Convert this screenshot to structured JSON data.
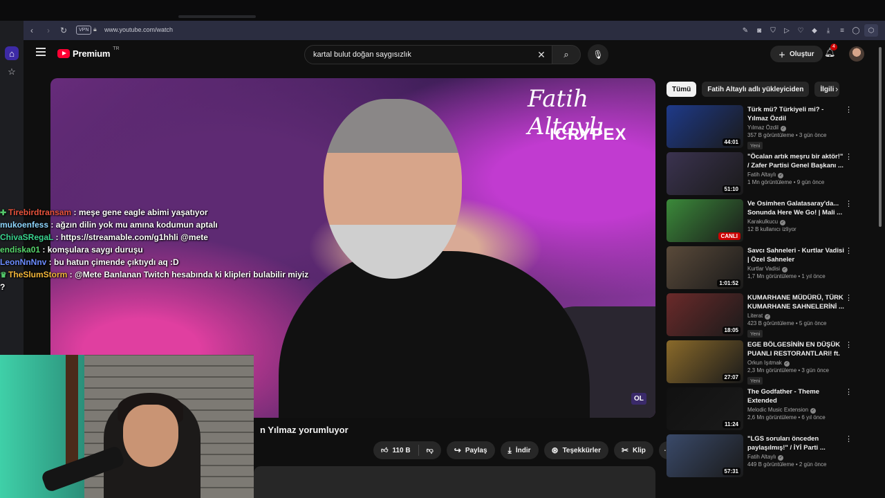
{
  "browser": {
    "url": "www.youtube.com/watch",
    "vpn_label": "VPN"
  },
  "header": {
    "logo_word": "Premium",
    "logo_country": "TR",
    "search_query": "kartal bulut doğan saygısızlık",
    "create_label": "Oluştur",
    "notification_count": "4"
  },
  "player": {
    "brand_line1": "Fatih Altaylı",
    "brand_line2": "ICRYPEX",
    "watermark": "OL"
  },
  "chat": [
    {
      "user": "Tirebirdtransam",
      "color": "#e8533c",
      "message": "meşe gene eagle abimi yaşatıyor",
      "badge": "✚"
    },
    {
      "user": "mukoenfess",
      "color": "#8fd7ff",
      "message": "ağzın dilin yok mu amına kodumun aptalı",
      "badge": ""
    },
    {
      "user": "ChivaSRegaL",
      "color": "#3ad58f",
      "message": "https://streamable.com/g1hhli @mete",
      "badge": ""
    },
    {
      "user": "endiska01",
      "color": "#57d66b",
      "message": "komşulara saygı duruşu",
      "badge": ""
    },
    {
      "user": "LeonNnNnv",
      "color": "#6b8cff",
      "message": "bu hatun çimende çıktıydı aq :D",
      "badge": ""
    },
    {
      "user": "TheSlumStorm",
      "color": "#f2b63a",
      "message": "@Mete Banlanan Twitch hesabında ki klipleri bulabilir miyiz",
      "badge": "♛"
    }
  ],
  "chat_trailing": "?",
  "video": {
    "title_partial": "n Yılmaz yorumluyor",
    "likes": "110 B",
    "share_label": "Paylaş",
    "download_label": "İndir",
    "thanks_label": "Teşekkürler",
    "clip_label": "Klip"
  },
  "chips": [
    "Tümü",
    "Fatih Altaylı adlı yükleyiciden",
    "İlgili"
  ],
  "recommendations": [
    {
      "title": "Türk mü? Türkiyeli mi? - Yılmaz Özdil",
      "channel": "Yılmaz Özdil",
      "meta": "357 B görüntüleme • 3 gün önce",
      "duration": "44:01",
      "badge": "Yeni",
      "live": false,
      "thumb_color": "#1e3a8a"
    },
    {
      "title": "\"Öcalan artık meşru bir aktör!\" / Zafer Partisi Genel Başkanı ...",
      "channel": "Fatih Altaylı",
      "meta": "1 Mn görüntüleme • 9 gün önce",
      "duration": "51:10",
      "badge": "",
      "live": false,
      "thumb_color": "#3b3350"
    },
    {
      "title": "Ve Osimhen Galatasaray'da... Sonunda Here We Go! | Mali ...",
      "channel": "Karakulkucu",
      "meta": "12 B kullanıcı izliyor",
      "duration": "CANLI",
      "badge": "",
      "live": true,
      "thumb_color": "#3b8a3a"
    },
    {
      "title": "Savcı Sahneleri - Kurtlar Vadisi | Özel Sahneler",
      "channel": "Kurtlar Vadisi",
      "meta": "1,7 Mn görüntüleme • 1 yıl önce",
      "duration": "1:01:52",
      "badge": "",
      "live": false,
      "thumb_color": "#5a4a3a"
    },
    {
      "title": "KUMARHANE MÜDÜRÜ, TÜRK KUMARHANE SAHNELERİNİ ...",
      "channel": "Literat",
      "meta": "423 B görüntüleme • 5 gün önce",
      "duration": "18:05",
      "badge": "Yeni",
      "live": false,
      "thumb_color": "#6b2a2a"
    },
    {
      "title": "EGE BÖLGESİNİN EN DÜŞÜK PUANLI RESTORANTLARI! ft. ...",
      "channel": "Orkun Işıtmak",
      "meta": "2,3 Mn görüntüleme • 3 gün önce",
      "duration": "27:07",
      "badge": "Yeni",
      "live": false,
      "thumb_color": "#8a6a2a"
    },
    {
      "title": "The Godfather - Theme Extended",
      "channel": "Melodic Music Extension",
      "meta": "2,6 Mn görüntüleme • 6 yıl önce",
      "duration": "11:24",
      "badge": "",
      "live": false,
      "thumb_color": "#111111"
    },
    {
      "title": "\"LGS soruları önceden paylaşılmış!\" / İYİ Parti ...",
      "channel": "Fatih Altaylı",
      "meta": "449 B görüntüleme • 2 gün önce",
      "duration": "57:31",
      "badge": "",
      "live": false,
      "thumb_color": "#3a4a6a"
    }
  ]
}
